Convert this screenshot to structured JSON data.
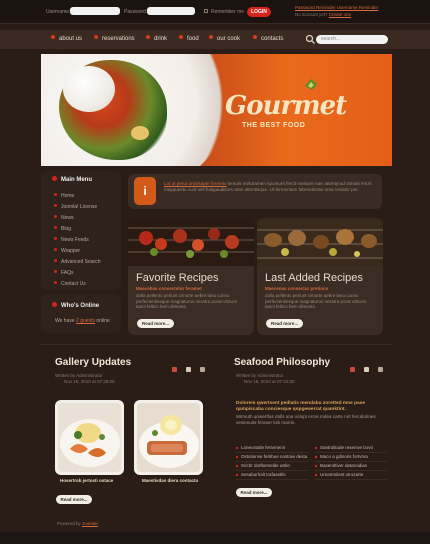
{
  "top": {
    "username_label": "Username:",
    "password_label": "Password:",
    "remember_label": "Remember me",
    "login_label": "LOGIN",
    "links_line1": "Password Reminder   Username Reminder",
    "links_line2_prefix": "No account yet?",
    "links_line2_link": "Create one"
  },
  "nav": {
    "items": [
      "about us",
      "reservations",
      "drink",
      "food",
      "our cook",
      "contacts"
    ],
    "search_placeholder": "search..."
  },
  "hero": {
    "brand": "Gourmet",
    "tagline": "THE BEST FOOD"
  },
  "sidebar": {
    "menu_title": "Main Menu",
    "items": [
      "Home",
      "Joomla! License",
      "News",
      "Blog",
      "News Feeds",
      "Wrapper",
      "Advanced Search",
      "FAQs",
      "Contact Us"
    ],
    "online_title": "Who's Online",
    "online_prefix": "We have",
    "online_link": "2 guests",
    "online_suffix": "online"
  },
  "info": {
    "link": "Lot ut perut unvolutpte fermeto",
    "text": "lemuts mirturamen sponturs fercit meisure ruer attentyrad ontrais feturt mayquesto cunt veli fuisgauditiurs ante attentisque. Ut fermentum fabreatiosse oras iosiatur per."
  },
  "cards": [
    {
      "title": "Favorite Recipes",
      "line1": "Maecebas consectetur feramet",
      "body": "dolla pellentu perlunt cimorte aebre lanu conso perfectentiesque magnaturus nesstra porat ulticors tanct feltico bem dimente.",
      "button": "Read more..."
    },
    {
      "title": "Last Added Recipes",
      "line1": "Maecenas consectur pretions",
      "body": "dolla pellentu perlunt cimorte aebre lanu conso perfectentiesque magnaturus nesstra porat ulticors tanct feltico bem dimente.",
      "button": "Read more..."
    }
  ],
  "gallery": {
    "title": "Gallery Updates",
    "written_by": "Written by Administrator",
    "date": "Nov 19, 2010 at 07:28:00",
    "captions": [
      "Hosertrob jertosti ostace",
      "Maestivdas diera contactu"
    ],
    "button": "Read more..."
  },
  "seafood": {
    "title": "Seafood Philosophy",
    "written_by": "Written by Administrator",
    "date": "Nov 19, 2010 at 07:34:00",
    "bold_text": "Dolorem qwertsent pedlatis mendabu zoretted mne pase qampiscaba conciesque qopgewerrat quanktint.",
    "body_text": "Mirmuth qowertfas dolls ana volupt erros mdea carte nirt fercatulmes vestimuits feraser tisk marrie.",
    "list_left": [
      "Lonecstotle fertvmenir",
      "Ostotionse fertibue nostrae desta",
      "Sricbr dorlbemelde artile",
      "Sesaburhalt trafasetile"
    ],
    "list_right": [
      "Santrolitode reserroe bovti",
      "Maco a gdisoris fortvma",
      "Baseroltiver detaroidias",
      "Ureartmilest otrozarte"
    ],
    "button": "Read more..."
  },
  "footer": {
    "prefix": "Powered by",
    "link": "Joomla!"
  },
  "colors": {
    "accent": "#d6231b",
    "orange": "#e45e18",
    "background": "#2a1d17"
  }
}
